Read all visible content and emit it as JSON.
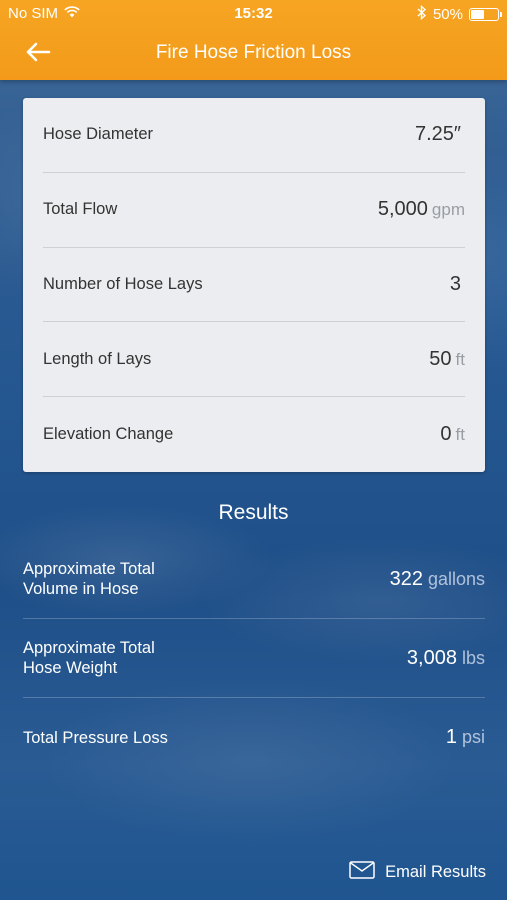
{
  "status_bar": {
    "carrier": "No SIM",
    "time": "15:32",
    "battery_percent": "50%",
    "battery_level": 0.5
  },
  "nav": {
    "title": "Fire Hose Friction Loss",
    "back_icon": "arrow-left-icon"
  },
  "inputs": [
    {
      "label": "Hose Diameter",
      "value": "7.25″",
      "unit": ""
    },
    {
      "label": "Total Flow",
      "value": "5,000",
      "unit": "gpm"
    },
    {
      "label": "Number of Hose Lays",
      "value": "3",
      "unit": ""
    },
    {
      "label": "Length of Lays",
      "value": "50",
      "unit": "ft"
    },
    {
      "label": "Elevation Change",
      "value": "0",
      "unit": "ft"
    }
  ],
  "results": {
    "title": "Results",
    "rows": [
      {
        "label_line1": "Approximate Total",
        "label_line2": "Volume in Hose",
        "value": "322",
        "unit": "gallons"
      },
      {
        "label_line1": "Approximate Total",
        "label_line2": "Hose Weight",
        "value": "3,008",
        "unit": "lbs"
      },
      {
        "label_line1": "Total Pressure Loss",
        "label_line2": "",
        "value": "1",
        "unit": "psi"
      }
    ]
  },
  "email": {
    "label": "Email Results",
    "icon": "envelope-icon"
  },
  "colors": {
    "header": "#f6a523",
    "background": "#245690",
    "card": "#ebedf0"
  }
}
